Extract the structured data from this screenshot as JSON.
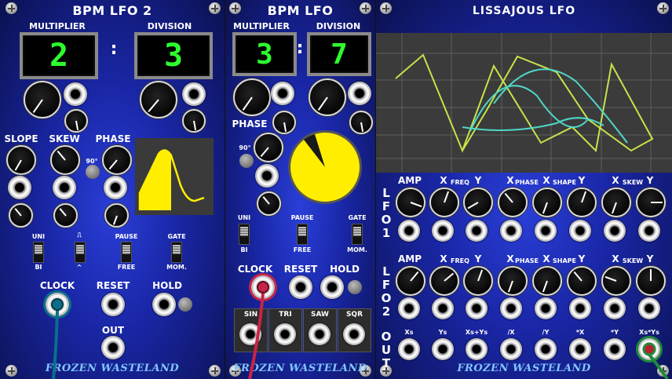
{
  "panel1": {
    "title": "BPM LFO 2",
    "multiplier_label": "MULTIPLIER",
    "division_label": "DIVISION",
    "multiplier_value": "2",
    "division_value": "3",
    "colon": ":",
    "slope_label": "SLOPE",
    "skew_label": "SKEW",
    "phase_label": "PHASE",
    "phase_90_label": "90°",
    "uni_label": "UNI",
    "bi_label": "BI",
    "wave_top_label": "⎍",
    "wave_bottom_label": "^",
    "pause_label": "PAUSE",
    "free_label": "FREE",
    "gate_label": "GATE",
    "mom_label": "MOM.",
    "clock_label": "CLOCK",
    "reset_label": "RESET",
    "hold_label": "HOLD",
    "out_label": "OUT",
    "brand": "FROZEN WASTELAND"
  },
  "panel2": {
    "title": "BPM LFO",
    "multiplier_label": "MULTIPLIER",
    "division_label": "DIVISION",
    "multiplier_value": "3",
    "division_value": "7",
    "colon": ":",
    "phase_label": "PHASE",
    "phase_90_label": "90°",
    "uni_label": "UNI",
    "bi_label": "BI",
    "pause_label": "PAUSE",
    "free_label": "FREE",
    "gate_label": "GATE",
    "mom_label": "MOM.",
    "clock_label": "CLOCK",
    "reset_label": "RESET",
    "hold_label": "HOLD",
    "outputs": [
      "SIN",
      "TRI",
      "SAW",
      "SQR"
    ],
    "brand": "FROZEN WASTELAND"
  },
  "panel3": {
    "title": "LISSAJOUS LFO",
    "lfo1_letters": [
      "L",
      "F",
      "O",
      "1"
    ],
    "lfo2_letters": [
      "L",
      "F",
      "O",
      "2"
    ],
    "out_letters": [
      "O",
      "U",
      "T"
    ],
    "amp_label": "AMP",
    "x_label": "X",
    "y_label": "Y",
    "freq_label": "FREQ",
    "phase_label": "PHASE",
    "shape_label": "SHAPE",
    "skew_label": "SKEW",
    "out_labels": [
      "Xs",
      "Ys",
      "Xs+Ys",
      "/X",
      "/Y",
      "*X",
      "*Y",
      "Xs*Ys"
    ],
    "brand": "FROZEN WASTELAND"
  },
  "colors": {
    "panel_blue": "#1a27a8",
    "led_green": "#2dff2d",
    "wave_yellow": "#ffee00",
    "scope_trace_yellow": "#c6e34a",
    "scope_trace_cyan": "#4fd6c8",
    "brand_blue": "#7fc6ff",
    "cable_teal": "#0a6f8a",
    "cable_red": "#c82445",
    "cable_green": "#1f8a3a"
  }
}
